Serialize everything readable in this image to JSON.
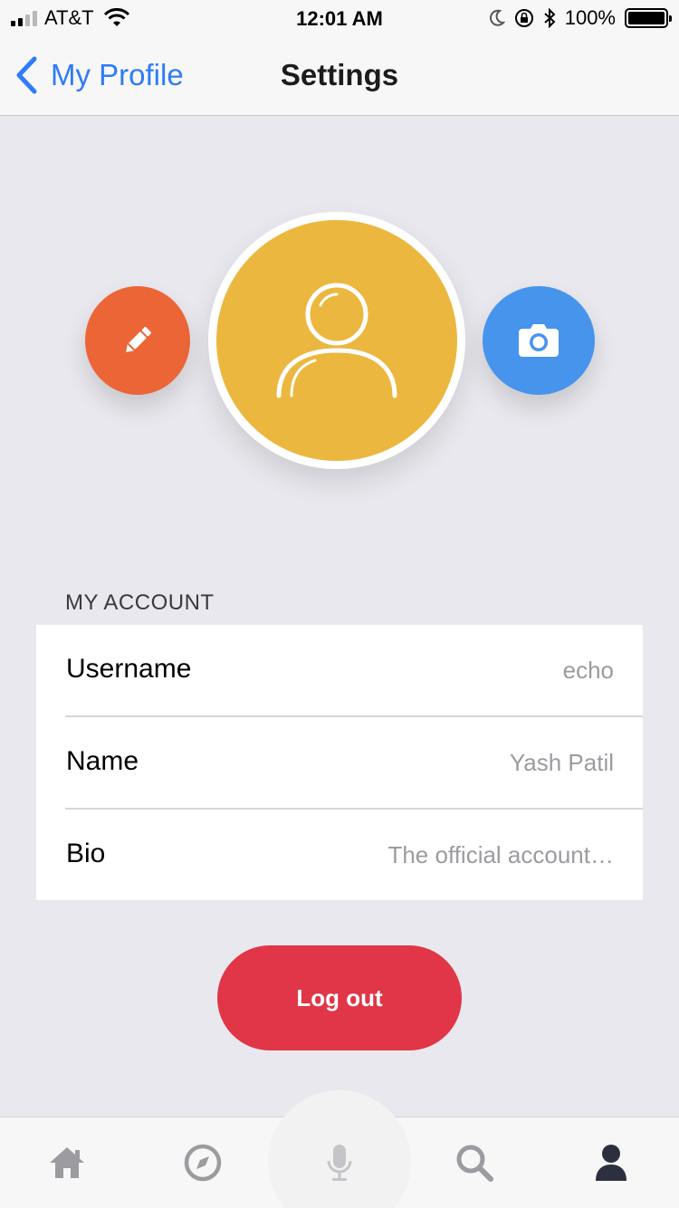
{
  "status_bar": {
    "carrier": "AT&T",
    "time": "12:01 AM",
    "battery": "100%"
  },
  "nav": {
    "back_label": "My Profile",
    "title": "Settings"
  },
  "colors": {
    "accent_blue": "#2f7cf6",
    "avatar_yellow": "#ebb73f",
    "edit_orange": "#ec6537",
    "camera_blue": "#4794ec",
    "logout_red": "#e03647"
  },
  "account": {
    "section_title": "MY ACCOUNT",
    "rows": [
      {
        "label": "Username",
        "value": "echo"
      },
      {
        "label": "Name",
        "value": "Yash Patil"
      },
      {
        "label": "Bio",
        "value": "The official account…"
      }
    ]
  },
  "logout_label": "Log out",
  "tab_bar": {
    "items": [
      {
        "icon": "home-icon",
        "active": false
      },
      {
        "icon": "compass-icon",
        "active": false
      },
      {
        "icon": "microphone-icon",
        "active": false
      },
      {
        "icon": "search-icon",
        "active": false
      },
      {
        "icon": "profile-icon",
        "active": true
      }
    ]
  }
}
